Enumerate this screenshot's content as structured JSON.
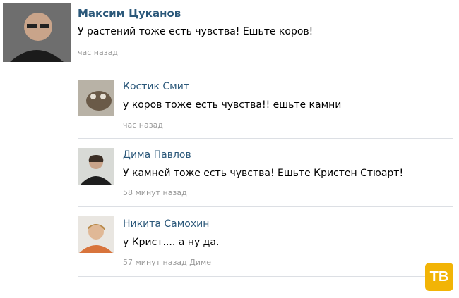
{
  "post": {
    "author": "Максим Цуканов",
    "text": "У растений тоже есть чувства! Ешьте коров!",
    "time": "час назад"
  },
  "replies": [
    {
      "author": "Костик Смит",
      "text": "у коров тоже есть чувства!! ешьте камни",
      "time": "час назад"
    },
    {
      "author": "Дима Павлов",
      "text": "У камней тоже есть чувства! Ешьте Кристен Стюарт!",
      "time": "58 минут назад"
    },
    {
      "author": "Никита Самохин",
      "text": "у Крист.... а ну да.",
      "time": "57 минут назад",
      "reply_to": "Диме"
    }
  ],
  "watermark": "ТВ",
  "colors": {
    "link": "#2b587a",
    "meta": "#999999",
    "divider": "#dcdfe4",
    "badge": "#f2b406"
  }
}
